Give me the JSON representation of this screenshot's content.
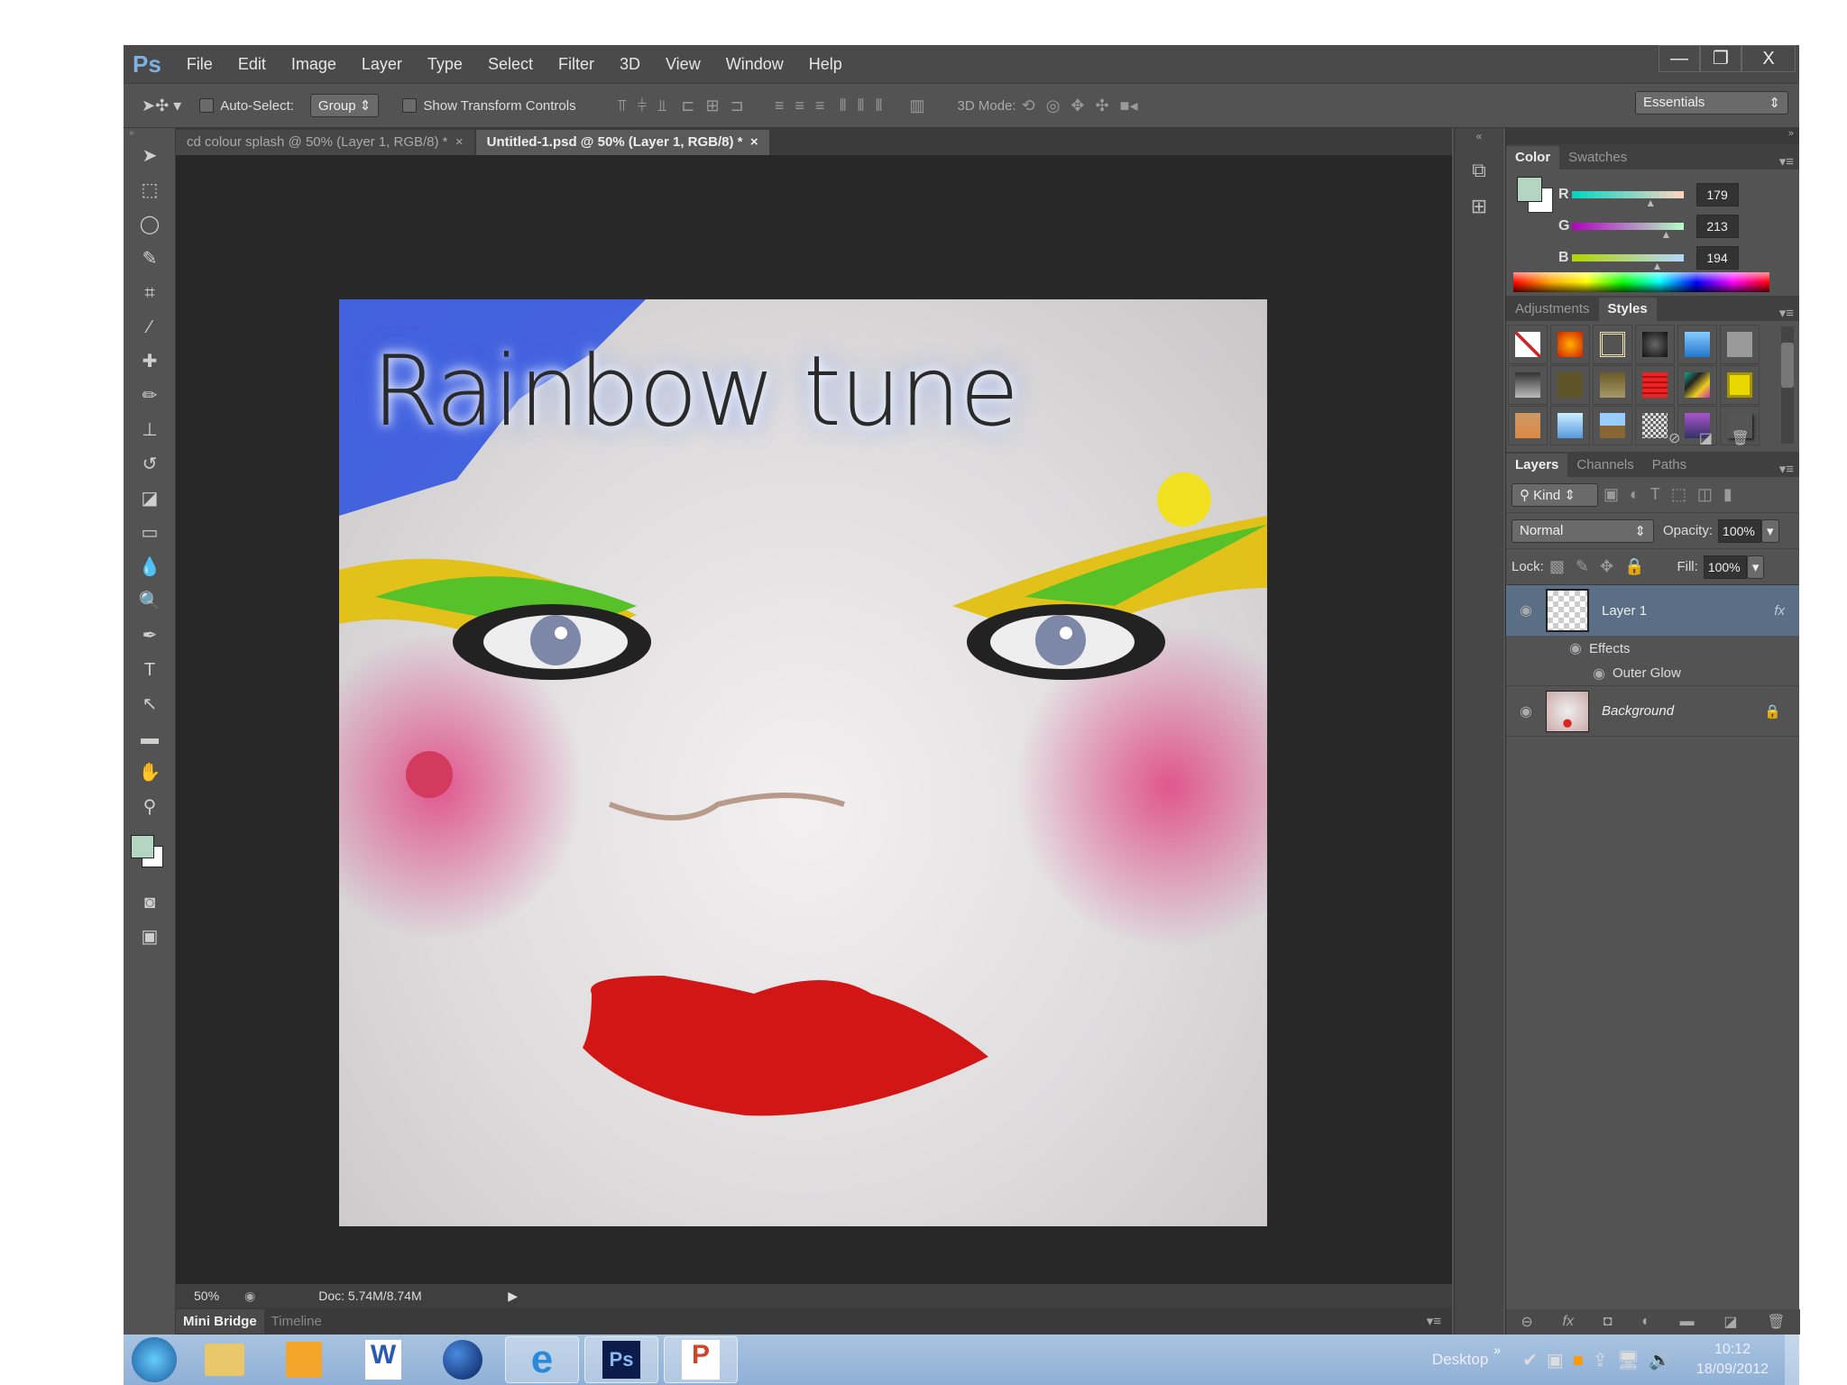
{
  "app": {
    "logo": "Ps",
    "menu": [
      "File",
      "Edit",
      "Image",
      "Layer",
      "Type",
      "Select",
      "Filter",
      "3D",
      "View",
      "Window",
      "Help"
    ],
    "window_controls": {
      "minimize": "—",
      "restore": "❐",
      "close": "X"
    }
  },
  "options": {
    "auto_select_label": "Auto-Select:",
    "auto_select_value": "Group",
    "show_transform_label": "Show Transform Controls",
    "mode_3d_label": "3D Mode:",
    "workspace": "Essentials"
  },
  "doc_tabs": [
    {
      "label": "cd colour splash @ 50% (Layer 1, RGB/8) *",
      "close": "×"
    },
    {
      "label": "Untitled-1.psd @ 50% (Layer 1, RGB/8) *",
      "close": "×"
    }
  ],
  "canvas": {
    "title_text": "Rainbow tune"
  },
  "status": {
    "zoom": "50%",
    "doc": "Doc: 5.74M/8.74M"
  },
  "bottom_tabs": [
    "Mini Bridge",
    "Timeline"
  ],
  "color_panel": {
    "tabs": [
      "Color",
      "Swatches"
    ],
    "foreground": "#b3d5c2",
    "channels": [
      {
        "label": "R",
        "value": "179",
        "fraction": 0.7
      },
      {
        "label": "G",
        "value": "213",
        "fraction": 0.84
      },
      {
        "label": "B",
        "value": "194",
        "fraction": 0.76
      }
    ]
  },
  "styles_panel": {
    "tabs": [
      "Adjustments",
      "Styles"
    ]
  },
  "layers_panel": {
    "tabs": [
      "Layers",
      "Channels",
      "Paths"
    ],
    "filter": "Kind",
    "blend_mode": "Normal",
    "opacity_label": "Opacity:",
    "opacity": "100%",
    "lock_label": "Lock:",
    "fill_label": "Fill:",
    "fill": "100%",
    "layers": [
      {
        "name": "Layer 1",
        "fx": "fx",
        "effects_label": "Effects",
        "effects": [
          "Outer Glow"
        ]
      },
      {
        "name": "Background"
      }
    ]
  },
  "taskbar": {
    "desktop_label": "Desktop",
    "chevron": "»",
    "time": "10:12",
    "date": "18/09/2012",
    "apps": [
      "start",
      "explorer",
      "outlook",
      "word",
      "globe",
      "internet-explorer",
      "photoshop",
      "powerpoint"
    ],
    "ps_label": "Ps",
    "word_label": "W",
    "ppt_label": "P"
  }
}
